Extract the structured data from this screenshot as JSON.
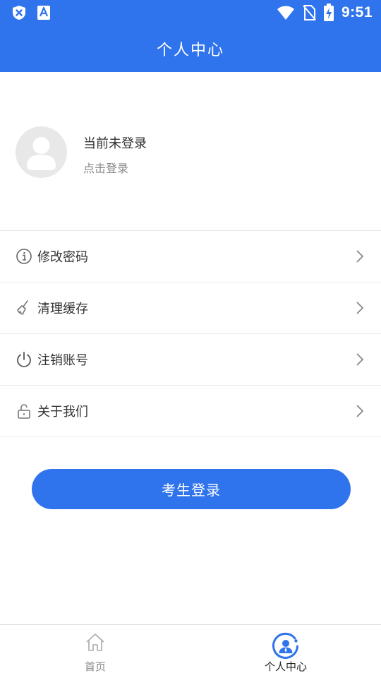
{
  "status_bar": {
    "time": "9:51",
    "icons": [
      "shield-x-icon",
      "font-a-icon",
      "wifi-icon",
      "no-sim-icon",
      "battery-charging-icon"
    ]
  },
  "header": {
    "title": "个人中心"
  },
  "profile": {
    "name": "当前未登录",
    "action": "点击登录",
    "avatar_icon": "avatar-placeholder-icon"
  },
  "menu": {
    "items": [
      {
        "label": "修改密码",
        "icon": "info-circle-icon"
      },
      {
        "label": "清理缓存",
        "icon": "broom-icon"
      },
      {
        "label": "注销账号",
        "icon": "power-icon"
      },
      {
        "label": "关于我们",
        "icon": "unlock-icon"
      }
    ]
  },
  "login_button": {
    "label": "考生登录"
  },
  "tabbar": {
    "tabs": [
      {
        "label": "首页",
        "icon": "home-icon",
        "active": false
      },
      {
        "label": "个人中心",
        "icon": "user-circle-icon",
        "active": true
      }
    ]
  },
  "colors": {
    "primary": "#2f74ec",
    "text": "#333333",
    "muted": "#888888"
  }
}
